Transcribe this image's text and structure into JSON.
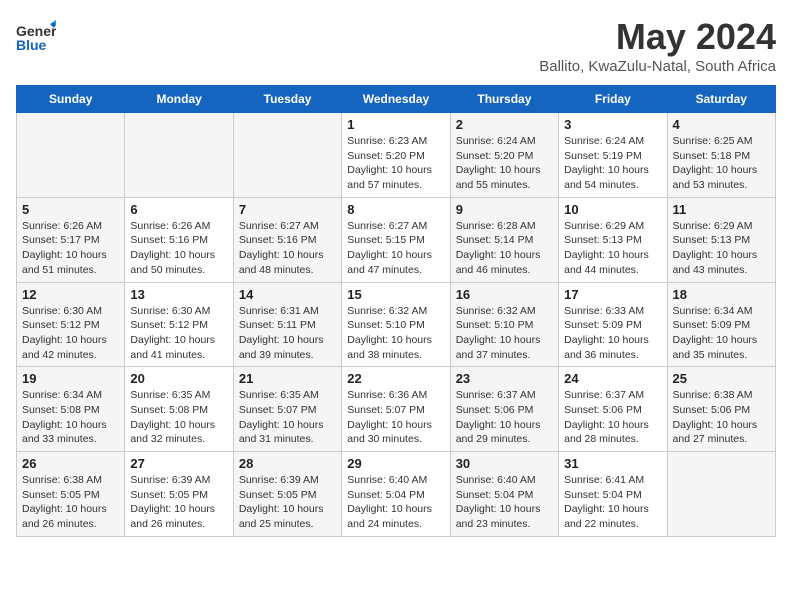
{
  "header": {
    "logo": {
      "general": "General",
      "blue": "Blue"
    },
    "title": "May 2024",
    "subtitle": "Ballito, KwaZulu-Natal, South Africa"
  },
  "days_of_week": [
    "Sunday",
    "Monday",
    "Tuesday",
    "Wednesday",
    "Thursday",
    "Friday",
    "Saturday"
  ],
  "weeks": [
    [
      {
        "day": "",
        "info": ""
      },
      {
        "day": "",
        "info": ""
      },
      {
        "day": "",
        "info": ""
      },
      {
        "day": "1",
        "info": "Sunrise: 6:23 AM\nSunset: 5:20 PM\nDaylight: 10 hours and 57 minutes."
      },
      {
        "day": "2",
        "info": "Sunrise: 6:24 AM\nSunset: 5:20 PM\nDaylight: 10 hours and 55 minutes."
      },
      {
        "day": "3",
        "info": "Sunrise: 6:24 AM\nSunset: 5:19 PM\nDaylight: 10 hours and 54 minutes."
      },
      {
        "day": "4",
        "info": "Sunrise: 6:25 AM\nSunset: 5:18 PM\nDaylight: 10 hours and 53 minutes."
      }
    ],
    [
      {
        "day": "5",
        "info": "Sunrise: 6:26 AM\nSunset: 5:17 PM\nDaylight: 10 hours and 51 minutes."
      },
      {
        "day": "6",
        "info": "Sunrise: 6:26 AM\nSunset: 5:16 PM\nDaylight: 10 hours and 50 minutes."
      },
      {
        "day": "7",
        "info": "Sunrise: 6:27 AM\nSunset: 5:16 PM\nDaylight: 10 hours and 48 minutes."
      },
      {
        "day": "8",
        "info": "Sunrise: 6:27 AM\nSunset: 5:15 PM\nDaylight: 10 hours and 47 minutes."
      },
      {
        "day": "9",
        "info": "Sunrise: 6:28 AM\nSunset: 5:14 PM\nDaylight: 10 hours and 46 minutes."
      },
      {
        "day": "10",
        "info": "Sunrise: 6:29 AM\nSunset: 5:13 PM\nDaylight: 10 hours and 44 minutes."
      },
      {
        "day": "11",
        "info": "Sunrise: 6:29 AM\nSunset: 5:13 PM\nDaylight: 10 hours and 43 minutes."
      }
    ],
    [
      {
        "day": "12",
        "info": "Sunrise: 6:30 AM\nSunset: 5:12 PM\nDaylight: 10 hours and 42 minutes."
      },
      {
        "day": "13",
        "info": "Sunrise: 6:30 AM\nSunset: 5:12 PM\nDaylight: 10 hours and 41 minutes."
      },
      {
        "day": "14",
        "info": "Sunrise: 6:31 AM\nSunset: 5:11 PM\nDaylight: 10 hours and 39 minutes."
      },
      {
        "day": "15",
        "info": "Sunrise: 6:32 AM\nSunset: 5:10 PM\nDaylight: 10 hours and 38 minutes."
      },
      {
        "day": "16",
        "info": "Sunrise: 6:32 AM\nSunset: 5:10 PM\nDaylight: 10 hours and 37 minutes."
      },
      {
        "day": "17",
        "info": "Sunrise: 6:33 AM\nSunset: 5:09 PM\nDaylight: 10 hours and 36 minutes."
      },
      {
        "day": "18",
        "info": "Sunrise: 6:34 AM\nSunset: 5:09 PM\nDaylight: 10 hours and 35 minutes."
      }
    ],
    [
      {
        "day": "19",
        "info": "Sunrise: 6:34 AM\nSunset: 5:08 PM\nDaylight: 10 hours and 33 minutes."
      },
      {
        "day": "20",
        "info": "Sunrise: 6:35 AM\nSunset: 5:08 PM\nDaylight: 10 hours and 32 minutes."
      },
      {
        "day": "21",
        "info": "Sunrise: 6:35 AM\nSunset: 5:07 PM\nDaylight: 10 hours and 31 minutes."
      },
      {
        "day": "22",
        "info": "Sunrise: 6:36 AM\nSunset: 5:07 PM\nDaylight: 10 hours and 30 minutes."
      },
      {
        "day": "23",
        "info": "Sunrise: 6:37 AM\nSunset: 5:06 PM\nDaylight: 10 hours and 29 minutes."
      },
      {
        "day": "24",
        "info": "Sunrise: 6:37 AM\nSunset: 5:06 PM\nDaylight: 10 hours and 28 minutes."
      },
      {
        "day": "25",
        "info": "Sunrise: 6:38 AM\nSunset: 5:06 PM\nDaylight: 10 hours and 27 minutes."
      }
    ],
    [
      {
        "day": "26",
        "info": "Sunrise: 6:38 AM\nSunset: 5:05 PM\nDaylight: 10 hours and 26 minutes."
      },
      {
        "day": "27",
        "info": "Sunrise: 6:39 AM\nSunset: 5:05 PM\nDaylight: 10 hours and 26 minutes."
      },
      {
        "day": "28",
        "info": "Sunrise: 6:39 AM\nSunset: 5:05 PM\nDaylight: 10 hours and 25 minutes."
      },
      {
        "day": "29",
        "info": "Sunrise: 6:40 AM\nSunset: 5:04 PM\nDaylight: 10 hours and 24 minutes."
      },
      {
        "day": "30",
        "info": "Sunrise: 6:40 AM\nSunset: 5:04 PM\nDaylight: 10 hours and 23 minutes."
      },
      {
        "day": "31",
        "info": "Sunrise: 6:41 AM\nSunset: 5:04 PM\nDaylight: 10 hours and 22 minutes."
      },
      {
        "day": "",
        "info": ""
      }
    ]
  ]
}
